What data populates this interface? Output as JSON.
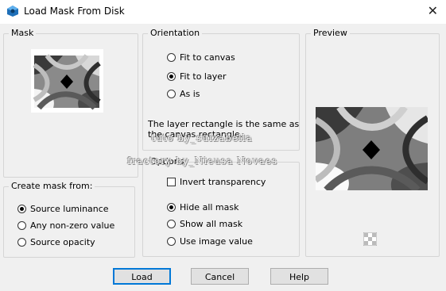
{
  "window": {
    "title": "Load Mask From Disk",
    "close_symbol": "✕"
  },
  "mask_group": {
    "label": "Mask"
  },
  "create_mask": {
    "label": "Create mask from:",
    "options": [
      {
        "label": "Source luminance",
        "checked": true
      },
      {
        "label": "Any non-zero value",
        "checked": false
      },
      {
        "label": "Source opacity",
        "checked": false
      }
    ]
  },
  "orientation": {
    "label": "Orientation",
    "options": [
      {
        "label": "Fit to canvas",
        "checked": false
      },
      {
        "label": "Fit to layer",
        "checked": true
      },
      {
        "label": "As is",
        "checked": false
      }
    ],
    "note": "The layer rectangle is the same as the canvas rectangle."
  },
  "options": {
    "label": "Options",
    "invert_label": "Invert transparency",
    "invert_checked": false,
    "radios": [
      {
        "label": "Hide all mask",
        "checked": true
      },
      {
        "label": "Show all mask",
        "checked": false
      },
      {
        "label": "Use image value",
        "checked": false
      }
    ]
  },
  "preview": {
    "label": "Preview"
  },
  "buttons": {
    "load": "Load",
    "cancel": "Cancel",
    "help": "Help"
  },
  "watermark": {
    "line1": "tuto by_suizabella",
    "line2": "fractory by_Nieusa Novaes"
  }
}
